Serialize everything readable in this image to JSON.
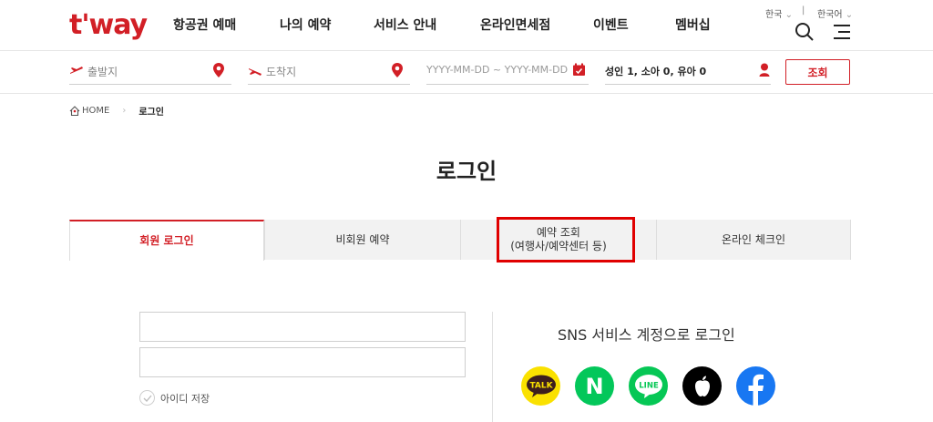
{
  "header": {
    "logo": "t'way",
    "nav": [
      "항공권 예매",
      "나의 예약",
      "서비스 안내",
      "온라인면세점",
      "이벤트",
      "멤버십"
    ],
    "lang_country": "한국",
    "lang_language": "한국어",
    "lang_sep": "|"
  },
  "search": {
    "origin_placeholder": "출발지",
    "destination_placeholder": "도착지",
    "dates_placeholder": "YYYY-MM-DD  ~ YYYY-MM-DD",
    "passengers": "성인 1, 소아 0, 유아 0",
    "search_label": "조회"
  },
  "breadcrumb": {
    "home": "HOME",
    "current": "로그인"
  },
  "page": {
    "title": "로그인"
  },
  "tabs": [
    {
      "label": "회원 로그인",
      "active": true
    },
    {
      "label": "비회원 예약",
      "active": false
    },
    {
      "label_line1": "예약 조회",
      "label_line2": "(여행사/예약센터 등)",
      "active": false
    },
    {
      "label": "온라인 체크인",
      "active": false
    }
  ],
  "login": {
    "save_id_label": "아이디 저장"
  },
  "sns": {
    "title": "SNS 서비스 계정으로 로그인",
    "kakao_text": "TALK",
    "naver_text": "N",
    "line_text": "LINE",
    "colors": {
      "kakao": "#fae100",
      "naver": "#03c75a",
      "line": "#06c755",
      "apple": "#000000",
      "facebook": "#1877f2"
    }
  },
  "colors": {
    "brand": "#d21f26",
    "highlight": "#e00000"
  }
}
